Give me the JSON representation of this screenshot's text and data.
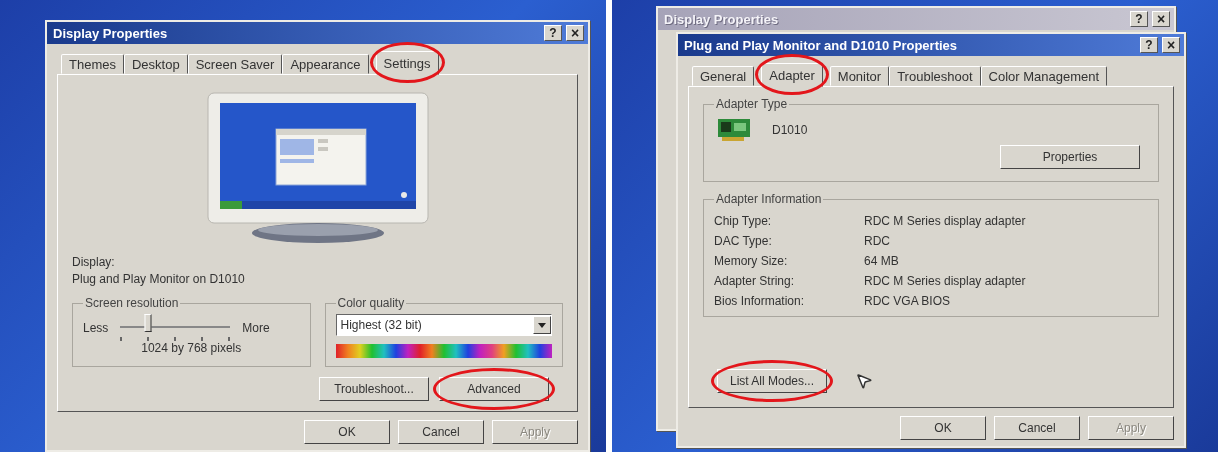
{
  "left": {
    "window": {
      "title": "Display Properties",
      "title_buttons": [
        {
          "kind": "help",
          "label": "?"
        },
        {
          "kind": "close",
          "label": "×"
        }
      ]
    },
    "tabs": [
      {
        "label": "Themes",
        "selected": false,
        "highlighted": false
      },
      {
        "label": "Desktop",
        "selected": false,
        "highlighted": false
      },
      {
        "label": "Screen Saver",
        "selected": false,
        "highlighted": false
      },
      {
        "label": "Appearance",
        "selected": false,
        "highlighted": false
      },
      {
        "label": "Settings",
        "selected": true,
        "highlighted": true
      }
    ],
    "display_label": "Display:",
    "display_value": "Plug and Play Monitor on D1010",
    "resolution": {
      "title": "Screen resolution",
      "less": "Less",
      "more": "More",
      "level": 0.25,
      "reading": "1024 by 768 pixels"
    },
    "color_quality": {
      "title": "Color quality",
      "value": "Highest (32 bit)"
    },
    "panel_buttons": [
      {
        "label": "Troubleshoot...",
        "highlighted": false
      },
      {
        "label": "Advanced",
        "highlighted": true
      }
    ],
    "buttons": [
      {
        "label": "OK",
        "disabled": false
      },
      {
        "label": "Cancel",
        "disabled": false
      },
      {
        "label": "Apply",
        "disabled": true
      }
    ]
  },
  "right": {
    "back_window": {
      "title": "Display Properties",
      "title_buttons": [
        {
          "kind": "help",
          "label": "?"
        },
        {
          "kind": "close",
          "label": "×"
        }
      ]
    },
    "window": {
      "title": "Plug and Play Monitor and D1010 Properties",
      "title_buttons": [
        {
          "kind": "help",
          "label": "?"
        },
        {
          "kind": "close",
          "label": "×"
        }
      ]
    },
    "tabs": [
      {
        "label": "General",
        "selected": false,
        "highlighted": false
      },
      {
        "label": "Adapter",
        "selected": true,
        "highlighted": true
      },
      {
        "label": "Monitor",
        "selected": false,
        "highlighted": false
      },
      {
        "label": "Troubleshoot",
        "selected": false,
        "highlighted": false
      },
      {
        "label": "Color Management",
        "selected": false,
        "highlighted": false
      }
    ],
    "adapter_type": {
      "title": "Adapter Type",
      "name": "D1010",
      "button": {
        "label": "Properties"
      }
    },
    "adapter_info": {
      "title": "Adapter Information",
      "rows": [
        {
          "label": "Chip Type:",
          "value": "RDC M Series display adapter"
        },
        {
          "label": "DAC Type:",
          "value": "RDC"
        },
        {
          "label": "Memory Size:",
          "value": "64 MB"
        },
        {
          "label": "Adapter String:",
          "value": "RDC M Series display adapter"
        },
        {
          "label": "Bios Information:",
          "value": "RDC VGA BIOS"
        }
      ]
    },
    "list_modes_button": {
      "label": "List All Modes...",
      "highlighted": true
    },
    "buttons": [
      {
        "label": "OK",
        "disabled": false
      },
      {
        "label": "Cancel",
        "disabled": false
      },
      {
        "label": "Apply",
        "disabled": true
      }
    ]
  }
}
